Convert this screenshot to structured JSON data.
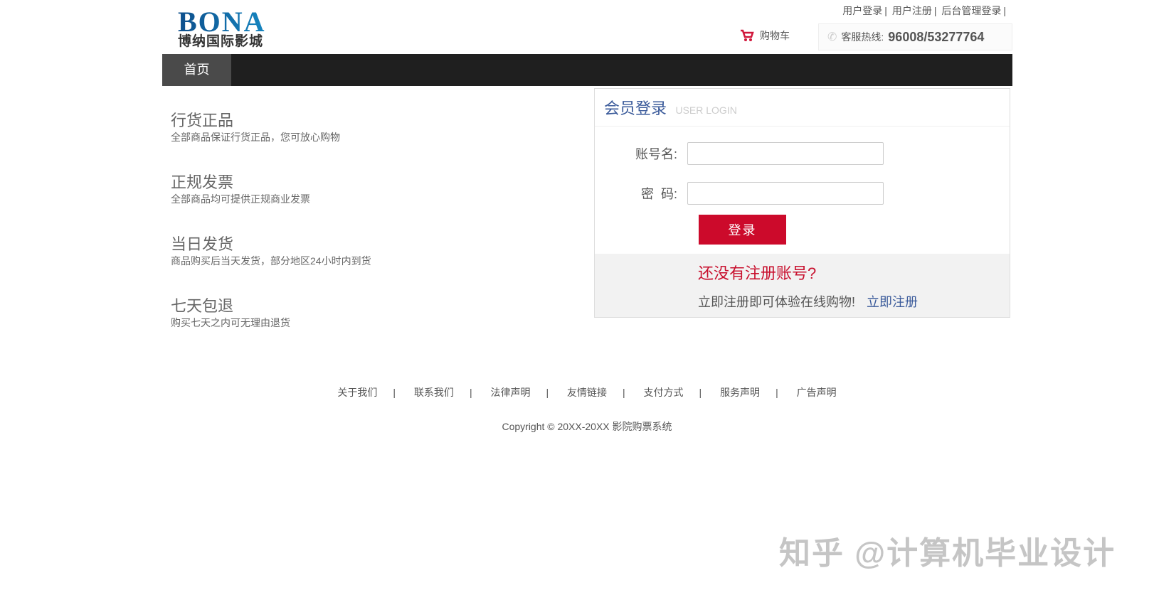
{
  "logo": {
    "en": "BONA",
    "cn": "博纳国际影城"
  },
  "toplinks": [
    "用户登录",
    "用户注册",
    "后台管理登录"
  ],
  "cart": "购物车",
  "hotline": {
    "label": "客服热线:",
    "number": "96008/53277764"
  },
  "nav": {
    "home": "首页"
  },
  "features": [
    {
      "title": "行货正品",
      "desc": "全部商品保证行货正品，您可放心购物"
    },
    {
      "title": "正规发票",
      "desc": "全部商品均可提供正规商业发票"
    },
    {
      "title": "当日发货",
      "desc": "商品购买后当天发货，部分地区24小时内到货"
    },
    {
      "title": "七天包退",
      "desc": "购买七天之内可无理由退货"
    }
  ],
  "login": {
    "title": "会员登录",
    "subtitle": "USER LOGIN",
    "username_label": "账号名:",
    "password_label": "密  码:",
    "username_value": "",
    "password_value": "",
    "submit": "登录",
    "no_account": "还没有注册账号?",
    "register_prompt": "立即注册即可体验在线购物!",
    "register_link": "立即注册"
  },
  "footer": {
    "links": [
      "关于我们",
      "联系我们",
      "法律声明",
      "友情链接",
      "支付方式",
      "服务声明",
      "广告声明"
    ],
    "separator": "|",
    "copyright": "Copyright © 20XX-20XX 影院购票系统"
  },
  "watermark": "知乎 @计算机毕业设计"
}
